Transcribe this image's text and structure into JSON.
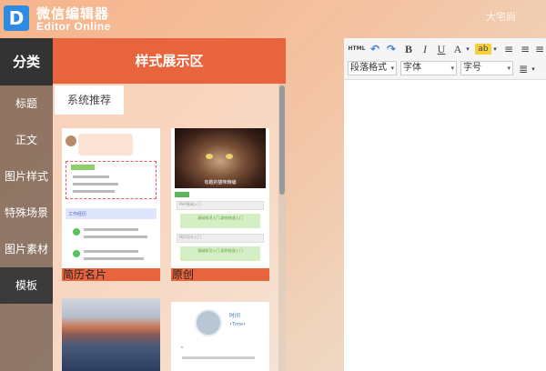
{
  "app": {
    "title_cn": "微信编辑器",
    "title_en": "Editor Online",
    "logo_letter": "D",
    "user_name": "大宅尚"
  },
  "sidebar": {
    "header": "分类",
    "items": [
      {
        "label": "标题"
      },
      {
        "label": "正文"
      },
      {
        "label": "图片样式"
      },
      {
        "label": "特殊场景"
      },
      {
        "label": "图片素材"
      },
      {
        "label": "模板"
      }
    ]
  },
  "main": {
    "header": "样式展示区",
    "tab": "系统推荐",
    "cards": [
      {
        "label": "简历名片"
      },
      {
        "label": "原创"
      },
      {
        "label": ""
      },
      {
        "label": ""
      }
    ],
    "card2_caption": "有趣的猫咪精编",
    "card4_time": "时间",
    "card4_sub": "•Time•",
    "card1_section": "工作经历",
    "card2_text1": "PHP基础入门",
    "card2_text2": "网页设计入门",
    "card2_green": "基础知识入门,助你快速入门"
  },
  "editor": {
    "toolbar": {
      "html": "HTML",
      "undo": "↶",
      "redo": "↷",
      "bold": "B",
      "italic": "I",
      "underline": "U",
      "font_color": "A",
      "highlight": "ab",
      "paragraph_format": "段落格式",
      "font_family": "字体",
      "font_size": "字号"
    }
  },
  "colors": {
    "accent": "#e8643c",
    "logo": "#2f8be0",
    "sidebar_head": "#333333"
  }
}
